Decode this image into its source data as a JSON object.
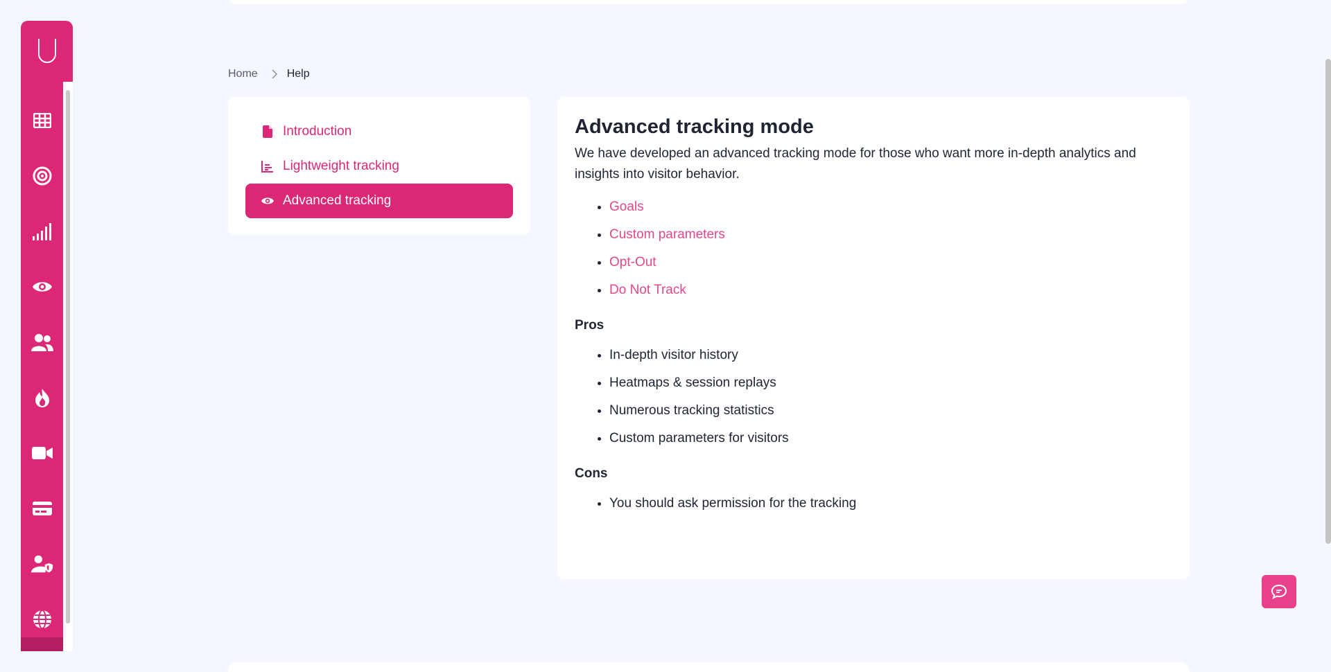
{
  "breadcrumb": {
    "home": "Home",
    "current": "Help"
  },
  "sidebar": {
    "logo": "U",
    "icons": [
      "grid-icon",
      "target-icon",
      "signal-bars-icon",
      "eye-icon",
      "users-icon",
      "fire-icon",
      "video-icon",
      "credit-card-icon",
      "user-shield-icon",
      "globe-icon"
    ]
  },
  "menu": {
    "items": [
      {
        "label": "Introduction",
        "icon": "file-icon"
      },
      {
        "label": "Lightweight tracking",
        "icon": "chart-icon"
      },
      {
        "label": "Advanced tracking",
        "icon": "eye-icon",
        "active": true
      }
    ]
  },
  "content": {
    "title": "Advanced tracking mode",
    "intro": "We have developed an advanced tracking mode for those who want more in-depth analytics and insights into visitor behavior.",
    "links": [
      "Goals",
      "Custom parameters",
      "Opt-Out",
      "Do Not Track"
    ],
    "pros_title": "Pros",
    "pros": [
      "In-depth visitor history",
      "Heatmaps & session replays",
      "Numerous tracking statistics",
      "Custom parameters for visitors"
    ],
    "cons_title": "Cons",
    "cons": [
      "You should ask permission for the tracking"
    ]
  },
  "colors": {
    "brand": "#dc2777",
    "link": "#e2478b",
    "background": "#f5f7ff"
  }
}
